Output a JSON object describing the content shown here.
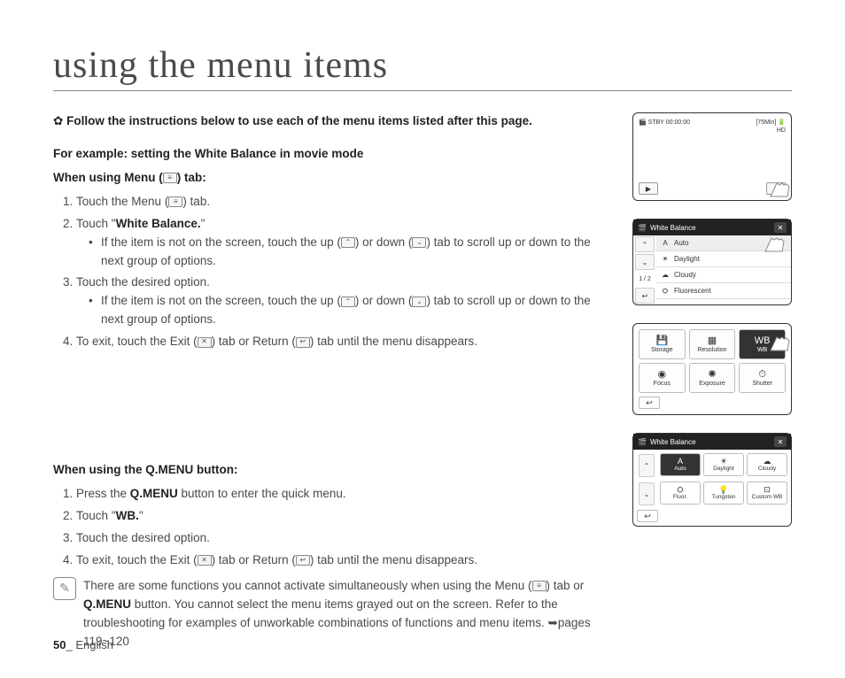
{
  "title": "using the menu items",
  "intro": "Follow the instructions below to use each of the menu items listed after this page.",
  "example_heading": "For example: setting the White Balance in movie mode",
  "menu_section": {
    "heading_prefix": "When using Menu (",
    "heading_suffix": ") tab:",
    "step1_a": "Touch the Menu (",
    "step1_b": ") tab.",
    "step2_a": "Touch \"",
    "step2_bold": "White Balance.",
    "step2_b": "\"",
    "scroll_a": "If the item is not on the screen, touch the up (",
    "scroll_b": ") or down (",
    "scroll_c": ") tab to scroll up or down to the next group of options.",
    "step3": "Touch the desired option.",
    "step4_a": "To exit, touch the Exit (",
    "step4_b": ") tab or Return (",
    "step4_c": ") tab until the menu disappears."
  },
  "qmenu_section": {
    "heading": "When using the Q.MENU button:",
    "step1_a": "Press the ",
    "step1_bold": "Q.MENU",
    "step1_b": " button to enter the quick menu.",
    "step2_a": "Touch \"",
    "step2_bold": "WB.",
    "step2_b": "\"",
    "step3": "Touch the desired option.",
    "step4_a": "To exit, touch the Exit (",
    "step4_b": ") tab or Return (",
    "step4_c": ") tab until the menu disappears."
  },
  "note_a": "There are some functions you cannot activate simultaneously when using the Menu (",
  "note_b": ") tab or ",
  "note_bold": "Q.MENU",
  "note_c": " button. You cannot select the menu items grayed out on the screen. Refer to the troubleshooting for examples of unworkable combinations of functions and menu items. ➥pages 119~120",
  "footer": {
    "page": "50",
    "sep": "_ ",
    "lang": "English"
  },
  "screens": {
    "s1": {
      "status": "STBY 00:00:00",
      "remain": "[75Min]",
      "hd": "HD"
    },
    "s2": {
      "title": "White Balance",
      "page": "1 / 2",
      "items": [
        "Auto",
        "Daylight",
        "Cloudy",
        "Fluorescent"
      ]
    },
    "s3": {
      "tiles": [
        "Storage",
        "Resolution",
        "WB",
        "Focus",
        "Exposure",
        "Shutter"
      ]
    },
    "s4": {
      "title": "White Balance",
      "tiles": [
        "Auto",
        "Daylight",
        "Cloudy",
        "Fluor.",
        "Tungsten",
        "Custom WB"
      ]
    }
  }
}
